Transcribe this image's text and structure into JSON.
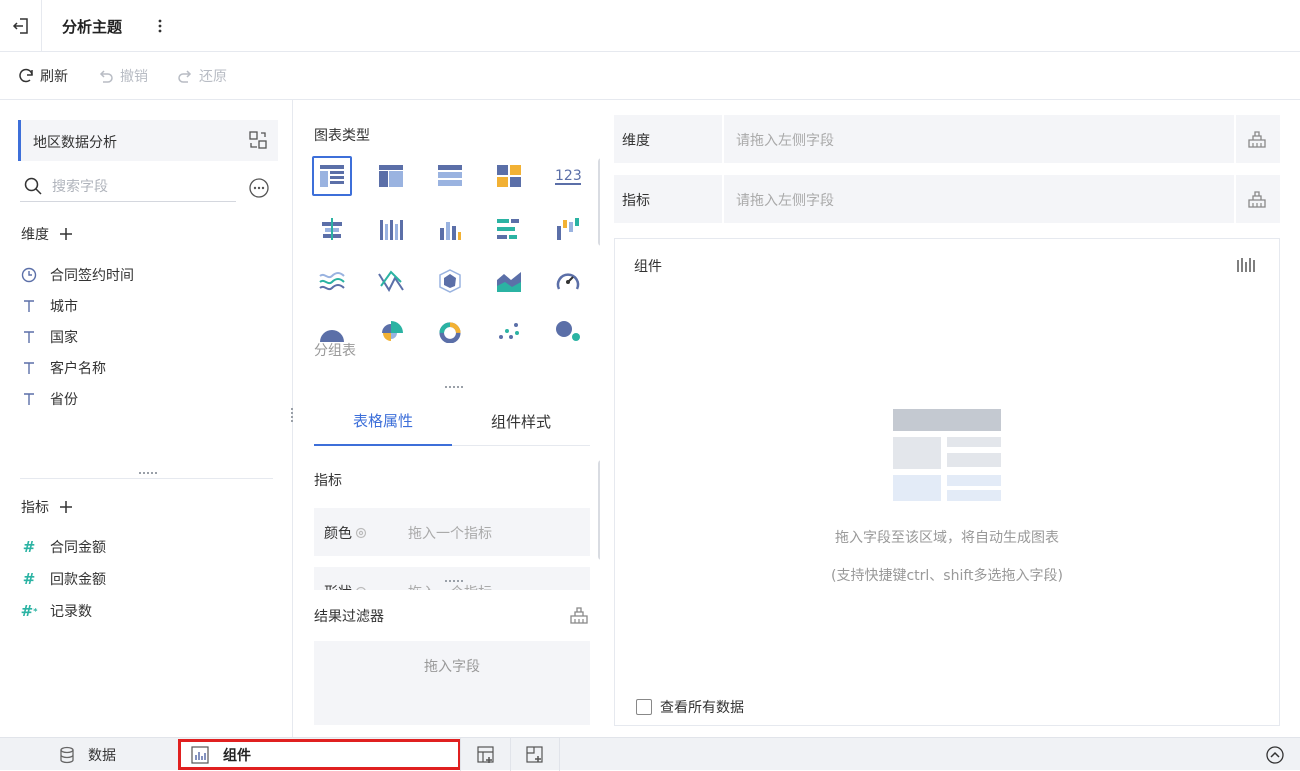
{
  "header": {
    "title": "分析主题"
  },
  "toolbar": {
    "refresh": "刷新",
    "undo": "撤销",
    "redo": "还原"
  },
  "left_panel": {
    "dataset_name": "地区数据分析",
    "search_placeholder": "搜索字段",
    "dimension_label": "维度",
    "dimensions": [
      "合同签约时间",
      "城市",
      "国家",
      "客户名称",
      "省份"
    ],
    "measure_label": "指标",
    "measures": [
      "合同金额",
      "回款金额",
      "记录数"
    ]
  },
  "middle_panel": {
    "chart_type_label": "图表类型",
    "selected_chart_caption": "分组表",
    "tabs": [
      "表格属性",
      "组件样式"
    ],
    "prop_section": "指标",
    "props": [
      {
        "label": "颜色",
        "placeholder": "拖入一个指标"
      },
      {
        "label": "形状",
        "placeholder": "拖入一个指标"
      }
    ],
    "filter_label": "结果过滤器",
    "filter_placeholder": "拖入字段"
  },
  "right_panel": {
    "dimension_shelf": {
      "label": "维度",
      "placeholder": "请拖入左侧字段"
    },
    "measure_shelf": {
      "label": "指标",
      "placeholder": "请拖入左侧字段"
    },
    "canvas_title": "组件",
    "empty_hint": "拖入字段至该区域，将自动生成图表",
    "empty_sub": "(支持快捷键ctrl、shift多选拖入字段)",
    "view_all": "查看所有数据"
  },
  "bottom_bar": {
    "data_tab": "数据",
    "component_tab": "组件"
  },
  "colors": {
    "accent": "#3d6fd9",
    "highlight_border": "#e02020",
    "teal": "#2bb3a3"
  }
}
